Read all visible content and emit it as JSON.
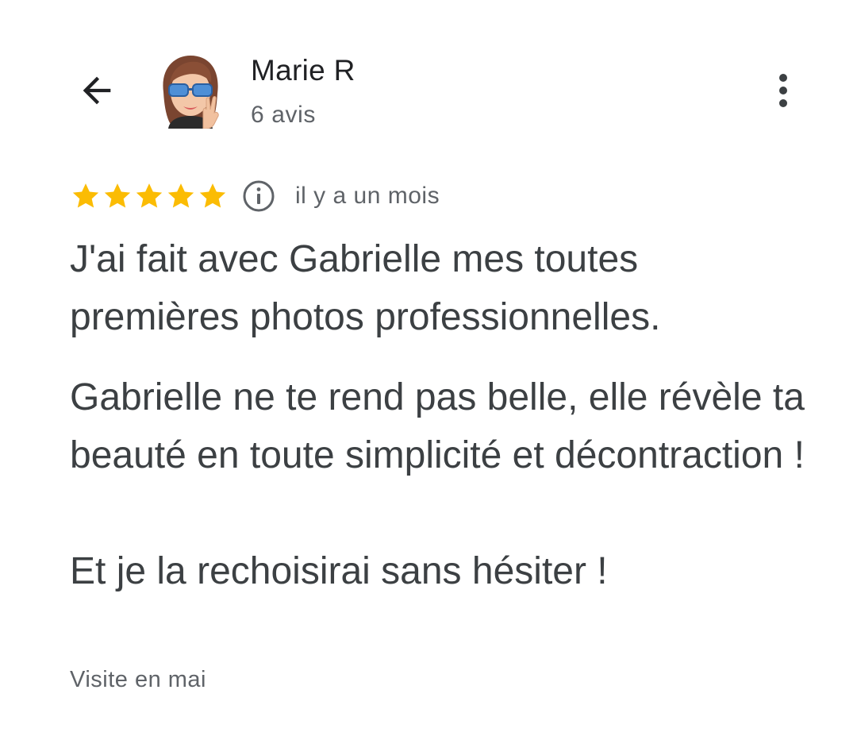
{
  "header": {
    "back_icon": "arrow-back-icon",
    "author_name": "Marie R",
    "author_meta": "6 avis",
    "avatar_icon": "memoji-avatar-icon",
    "more_icon": "more-vert-icon"
  },
  "review": {
    "rating": 5,
    "rating_max": 5,
    "star_color": "#fbbc04",
    "info_icon": "info-icon",
    "time": "il y a un mois",
    "paragraphs": [
      "J'ai fait avec Gabrielle mes toutes premières photos professionnelles.",
      "Gabrielle ne te rend pas belle, elle révèle ta beauté en toute simplicité et décontraction !",
      "Et je la rechoisirai sans hésiter !"
    ],
    "visit": "Visite en mai"
  },
  "colors": {
    "text_primary": "#202124",
    "text_body": "#3c4043",
    "text_secondary": "#5f6368"
  }
}
